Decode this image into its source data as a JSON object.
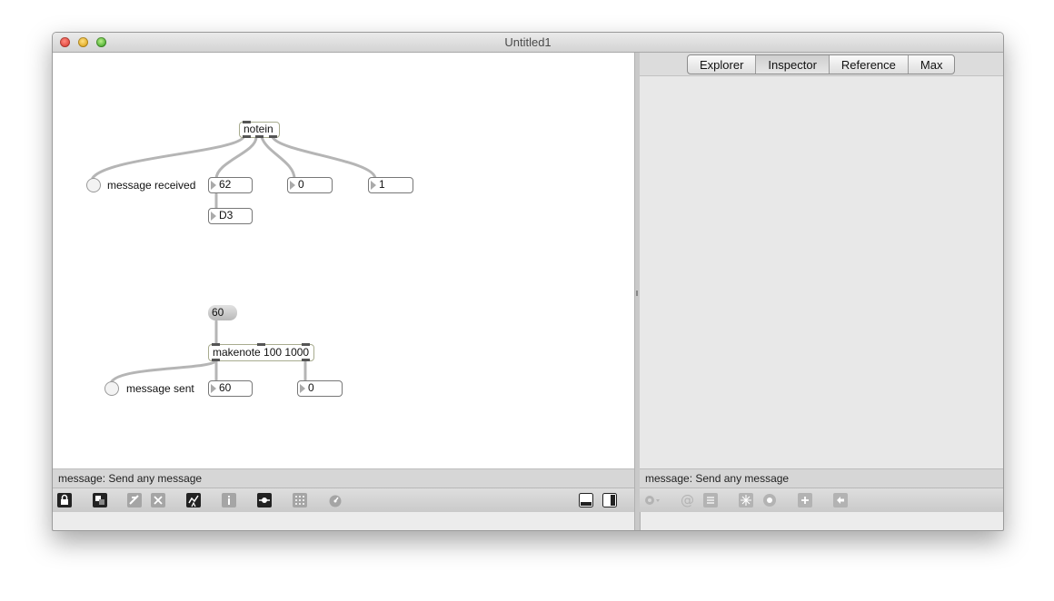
{
  "window": {
    "title": "Untitled1"
  },
  "patcher": {
    "notein": "notein",
    "notein_led_label": "message received",
    "notein_pitch": "62",
    "notein_velocity": "0",
    "notein_channel": "1",
    "note_name": "D3",
    "message_box": "60",
    "makenote": "makenote 100 1000",
    "makenote_led_label": "message sent",
    "makenote_pitch": "60",
    "makenote_velocity": "0"
  },
  "sidebar": {
    "tabs": [
      "Explorer",
      "Inspector",
      "Reference",
      "Max"
    ],
    "active_tab": "Inspector"
  },
  "status": {
    "patcher": "message: Send any message",
    "sidebar": "message: Send any message"
  },
  "colors": {
    "object_border": "#a8ac8f",
    "cord": "#b5b5b5"
  },
  "icons": {
    "patcher_toolbar": [
      "lock-icon",
      "presentation-icon",
      "object-palette-icon",
      "delete-icon",
      "debug-icon",
      "info-icon",
      "connect-icon",
      "grid-icon",
      "audio-icon",
      "patcher-view-icon",
      "split-view-icon"
    ],
    "sidebar_toolbar": [
      "action-menu-icon",
      "attribute-icon",
      "list-icon",
      "freeze-icon",
      "settings-icon",
      "add-icon",
      "back-icon"
    ]
  }
}
